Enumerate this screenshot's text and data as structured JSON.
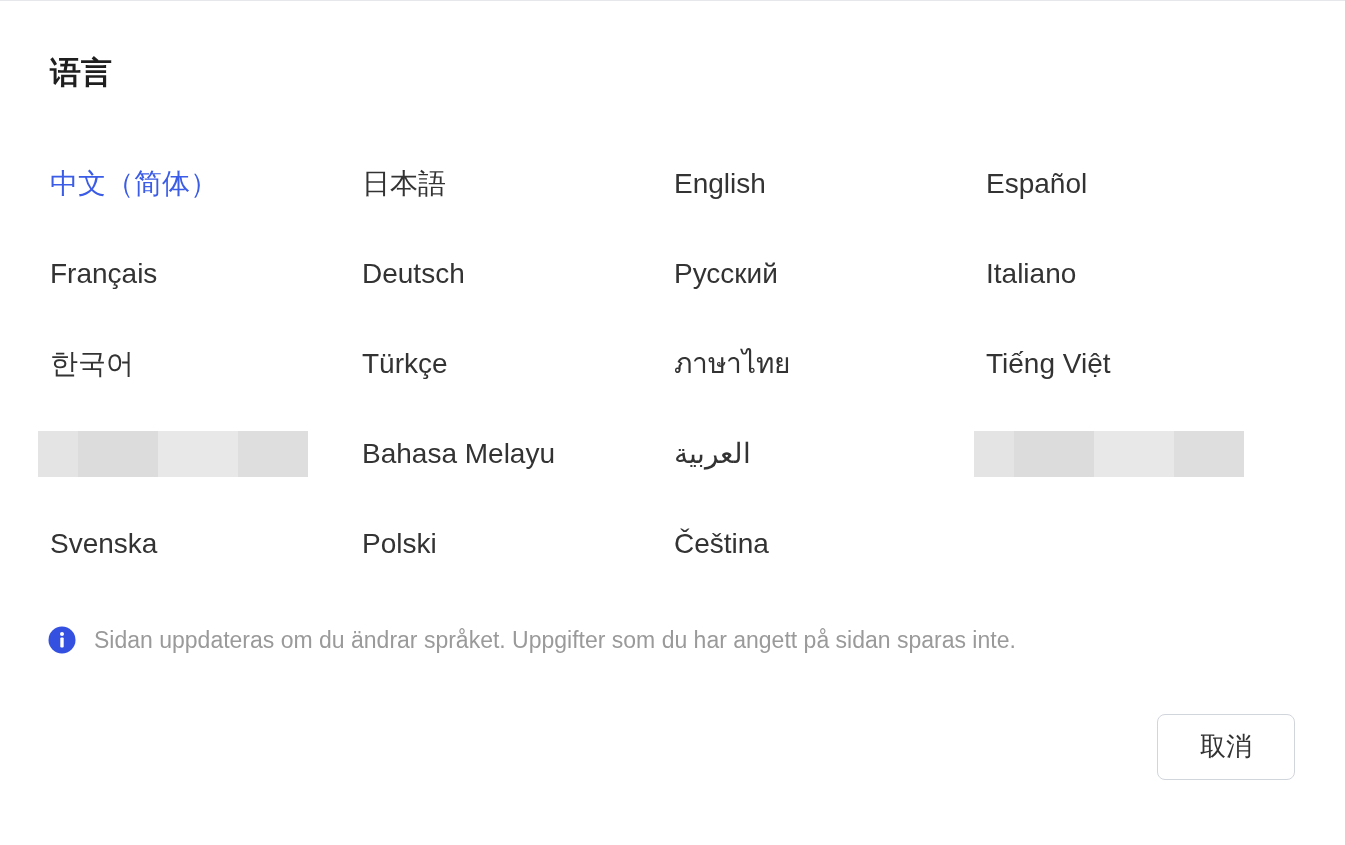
{
  "dialog": {
    "title": "语言"
  },
  "languages": [
    {
      "kind": "language",
      "label": "中文（简体）",
      "selected": true
    },
    {
      "kind": "language",
      "label": "日本語",
      "selected": false
    },
    {
      "kind": "language",
      "label": "English",
      "selected": false
    },
    {
      "kind": "language",
      "label": "Español",
      "selected": false
    },
    {
      "kind": "language",
      "label": "Français",
      "selected": false
    },
    {
      "kind": "language",
      "label": "Deutsch",
      "selected": false
    },
    {
      "kind": "language",
      "label": "Русский",
      "selected": false
    },
    {
      "kind": "language",
      "label": "Italiano",
      "selected": false
    },
    {
      "kind": "language",
      "label": "한국어",
      "selected": false
    },
    {
      "kind": "language",
      "label": "Türkçe",
      "selected": false
    },
    {
      "kind": "language",
      "label": "ภาษาไทย",
      "selected": false
    },
    {
      "kind": "language",
      "label": "Tiếng Việt",
      "selected": false
    },
    {
      "kind": "redacted"
    },
    {
      "kind": "language",
      "label": "Bahasa Melayu",
      "selected": false
    },
    {
      "kind": "language",
      "label": "العربية",
      "selected": false
    },
    {
      "kind": "redacted"
    },
    {
      "kind": "language",
      "label": "Svenska",
      "selected": false
    },
    {
      "kind": "language",
      "label": "Polski",
      "selected": false
    },
    {
      "kind": "language",
      "label": "Čeština",
      "selected": false
    }
  ],
  "notice": "Sidan uppdateras om du ändrar språket. Uppgifter som du har angett på sidan sparas inte.",
  "buttons": [
    "取消"
  ]
}
